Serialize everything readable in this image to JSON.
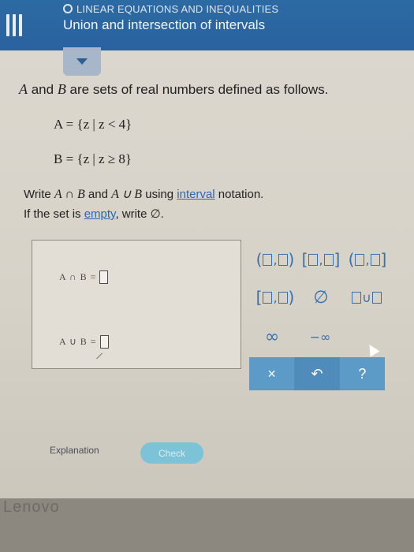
{
  "header": {
    "topic": "LINEAR EQUATIONS AND INEQUALITIES",
    "title": "Union and intersection of intervals"
  },
  "problem": {
    "intro_italic_a": "A",
    "intro_and": " and ",
    "intro_italic_b": "B",
    "intro_rest": " are sets of real numbers defined as follows.",
    "set_a": "A = {z | z < 4}",
    "set_b": "B = {z | z ≥ 8}",
    "instruction_prefix": "Write ",
    "instruction_intersect": "A ∩ B",
    "instruction_and": " and ",
    "instruction_union": "A ∪ B",
    "instruction_using": " using ",
    "instruction_link": "interval",
    "instruction_suffix": " notation.",
    "empty_prefix": "If the set is ",
    "empty_link": "empty",
    "empty_suffix": ", write ∅."
  },
  "answer": {
    "intersect_label": "A ∩ B =",
    "union_label": "A ∪ B ="
  },
  "palette": {
    "infinity": "∞",
    "neg_infinity": "−∞",
    "empty_set": "∅",
    "union": "∪",
    "clear": "×",
    "undo": "↶",
    "help": "?"
  },
  "footer": {
    "explanation": "Explanation",
    "check": "Check"
  },
  "bezel": {
    "brand": "Lenovo"
  }
}
